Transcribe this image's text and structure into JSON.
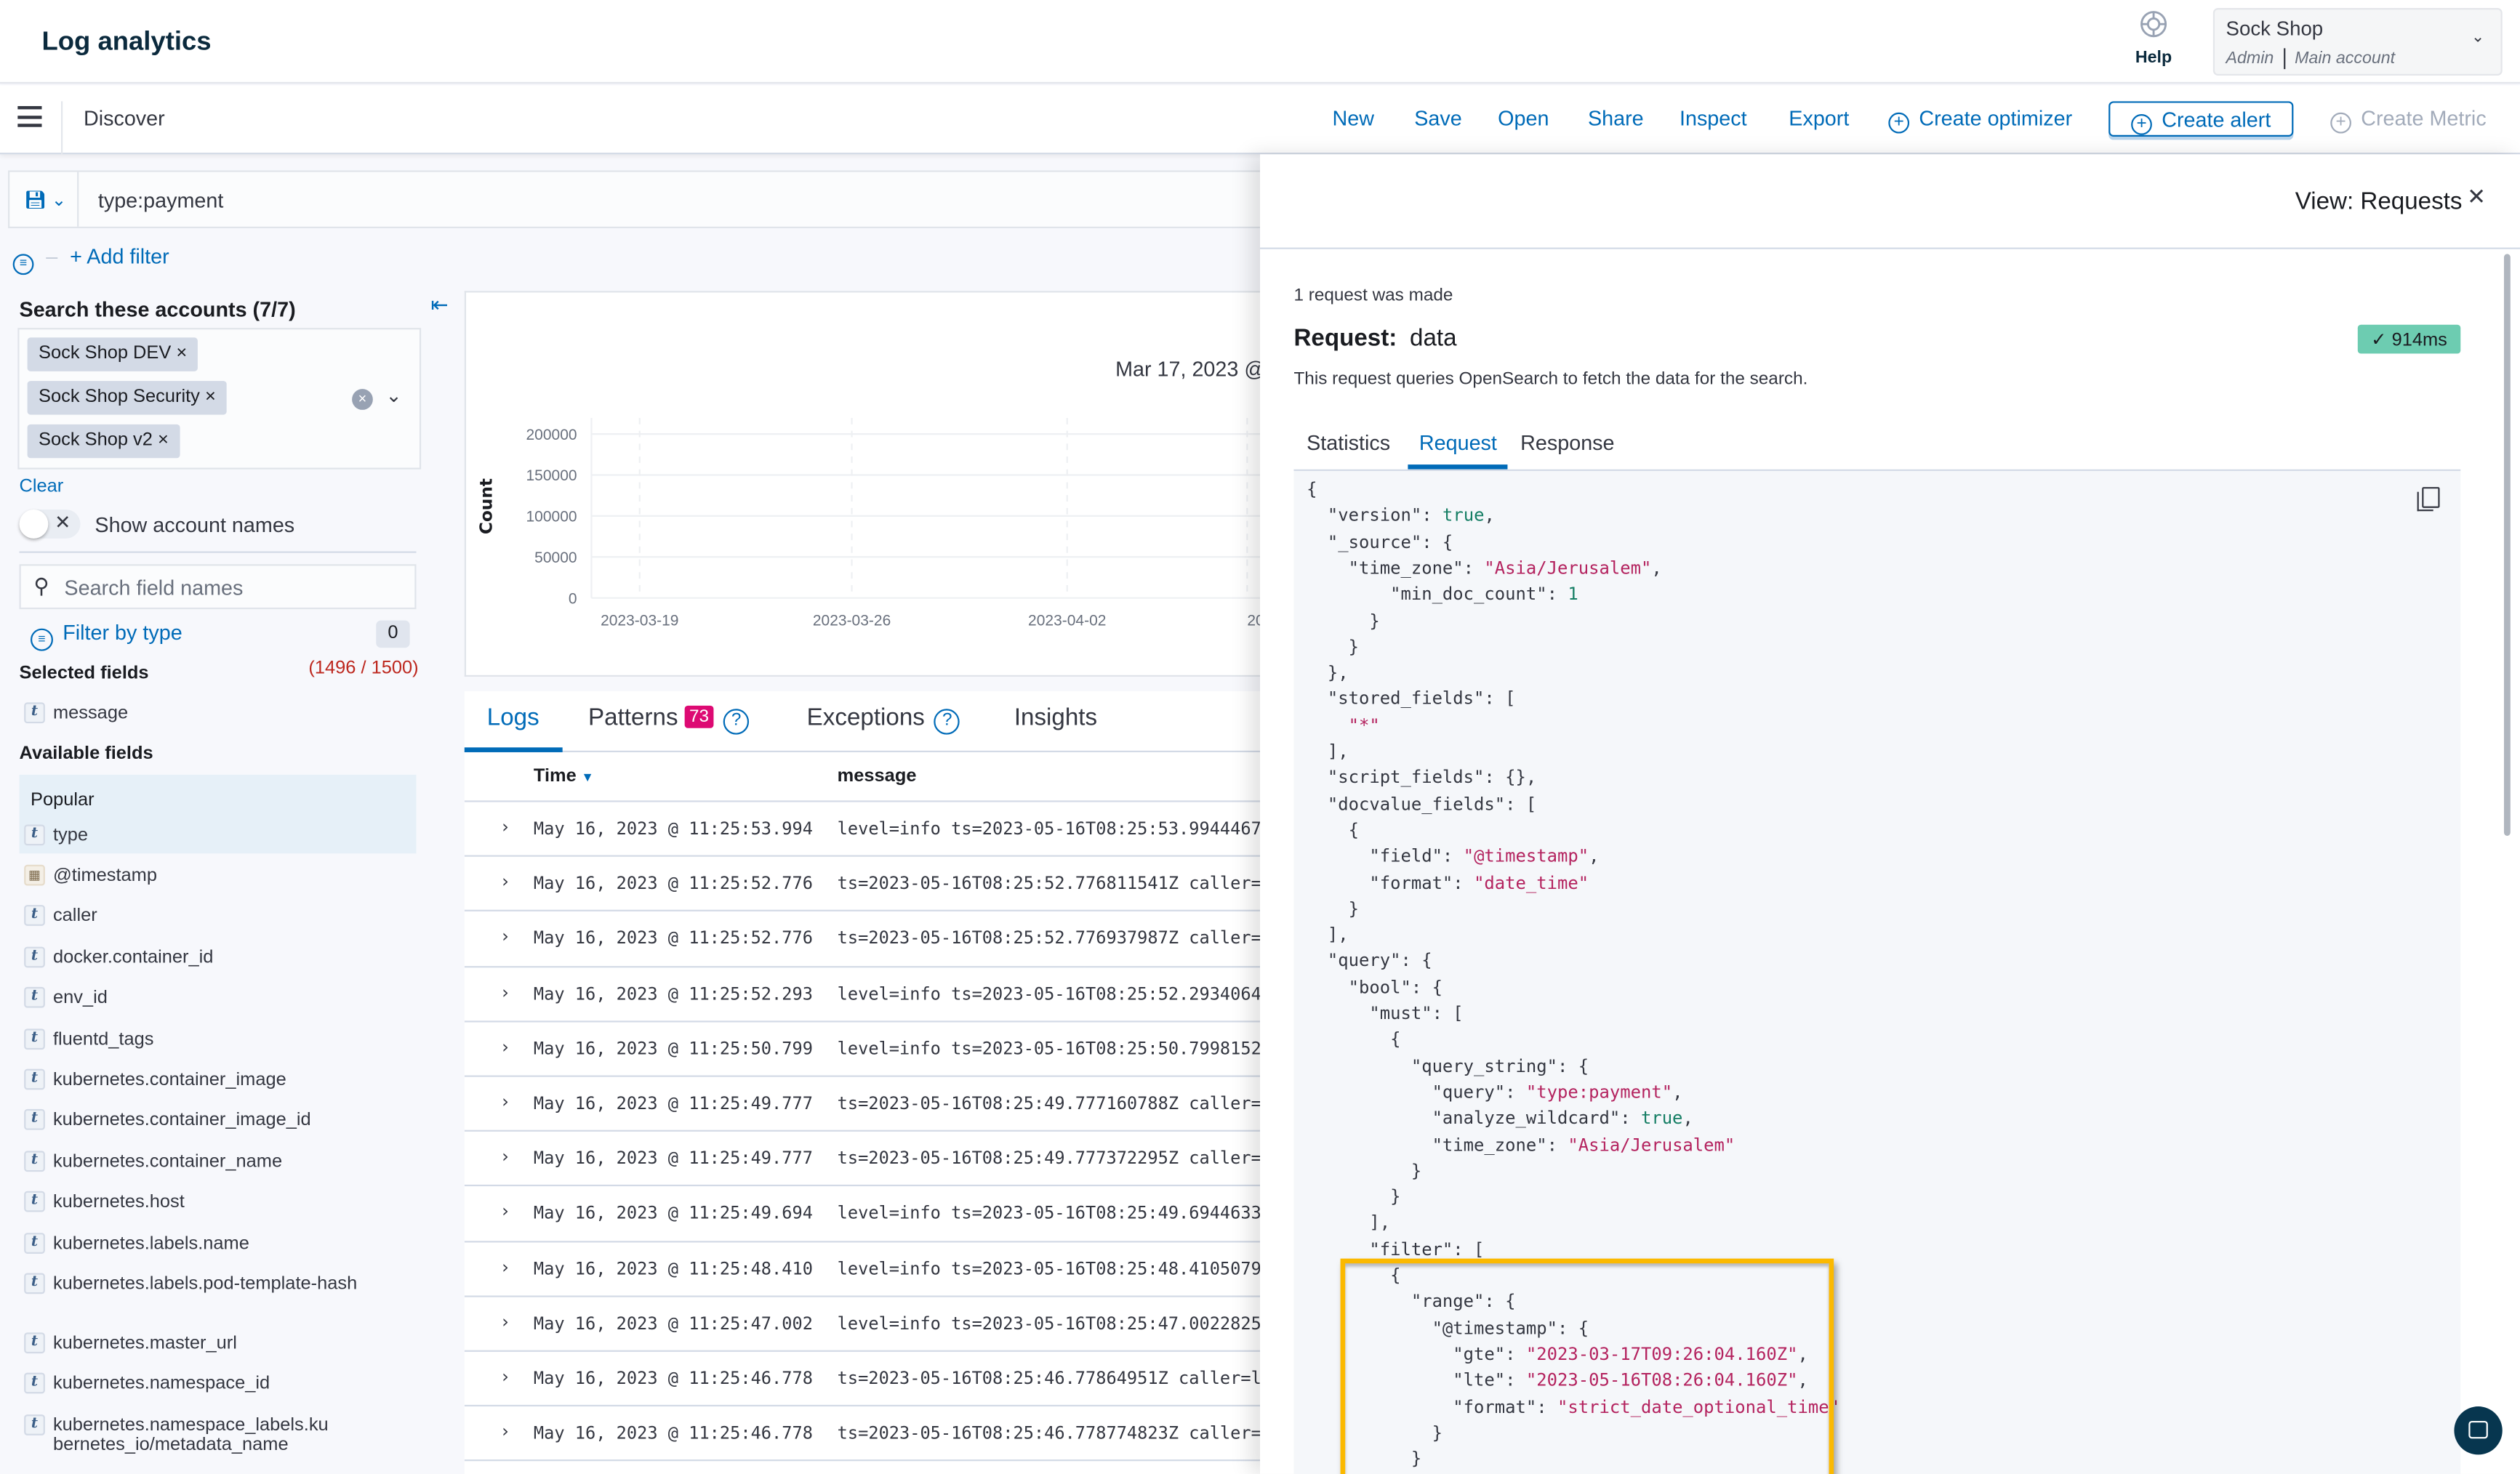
{
  "header": {
    "app_title": "Log analytics",
    "help_label": "Help",
    "account": {
      "name": "Sock Shop",
      "role": "Admin",
      "scope": "Main account"
    }
  },
  "toolbar": {
    "page": "Discover",
    "actions": [
      "New",
      "Save",
      "Open",
      "Share",
      "Inspect",
      "Export"
    ],
    "create_optimizer": "Create optimizer",
    "create_alert": "Create alert",
    "create_metric": "Create Metric"
  },
  "query": {
    "value": "type:payment",
    "add_filter": "+ Add filter"
  },
  "sidebar": {
    "accounts_title": "Search these accounts (7/7)",
    "accounts": [
      "Sock Shop DEV",
      "Sock Shop Security",
      "Sock Shop v2"
    ],
    "clear": "Clear",
    "show_account_names": "Show account names",
    "show_account_names_on": false,
    "search_placeholder": "Search field names",
    "filter_by_type": "Filter by type",
    "filter_count": "0",
    "selected_title": "Selected fields",
    "selected_count": "(1496 / 1500)",
    "selected_fields": [
      {
        "name": "message",
        "type": "string"
      }
    ],
    "available_title": "Available fields",
    "popular_label": "Popular",
    "popular_fields": [
      {
        "name": "type",
        "type": "string"
      }
    ],
    "available_fields": [
      {
        "name": "@timestamp",
        "type": "date"
      },
      {
        "name": "caller",
        "type": "string"
      },
      {
        "name": "docker.container_id",
        "type": "string"
      },
      {
        "name": "env_id",
        "type": "string"
      },
      {
        "name": "fluentd_tags",
        "type": "string"
      },
      {
        "name": "kubernetes.container_image",
        "type": "string"
      },
      {
        "name": "kubernetes.container_image_id",
        "type": "string"
      },
      {
        "name": "kubernetes.container_name",
        "type": "string"
      },
      {
        "name": "kubernetes.host",
        "type": "string"
      },
      {
        "name": "kubernetes.labels.name",
        "type": "string"
      },
      {
        "name": "kubernetes.labels.pod-template-hash",
        "type": "string"
      },
      {
        "name": "kubernetes.master_url",
        "type": "string"
      },
      {
        "name": "kubernetes.namespace_id",
        "type": "string"
      },
      {
        "name": "kubernetes.namespace_labels.kubernetes_io/metadata_name",
        "type": "string"
      }
    ]
  },
  "histogram": {
    "time_range_label": "Mar 17, 2023 @",
    "ylabel": "Count",
    "y_ticks": [
      "200000",
      "150000",
      "100000",
      "50000",
      "0"
    ],
    "x_ticks": [
      "2023-03-19",
      "2023-03-26",
      "2023-04-02",
      "20"
    ]
  },
  "chart_data": {
    "type": "bar",
    "ylabel": "Count",
    "ylim": [
      0,
      200000
    ],
    "y_ticks": [
      0,
      50000,
      100000,
      150000,
      200000
    ],
    "x_ticks": [
      "2023-03-19",
      "2023-03-26",
      "2023-04-02"
    ],
    "grid": true,
    "series": []
  },
  "log_tabs": {
    "logs": "Logs",
    "patterns": "Patterns",
    "patterns_count": "73",
    "exceptions": "Exceptions",
    "insights": "Insights"
  },
  "log_table": {
    "columns": [
      "Time",
      "message"
    ],
    "rows": [
      {
        "time": "May 16, 2023 @ 11:25:53.994",
        "message": "level=info ts=2023-05-16T08:25:53.9944467"
      },
      {
        "time": "May 16, 2023 @ 11:25:52.776",
        "message": "ts=2023-05-16T08:25:52.776811541Z caller="
      },
      {
        "time": "May 16, 2023 @ 11:25:52.776",
        "message": "ts=2023-05-16T08:25:52.776937987Z caller="
      },
      {
        "time": "May 16, 2023 @ 11:25:52.293",
        "message": "level=info ts=2023-05-16T08:25:52.2934064"
      },
      {
        "time": "May 16, 2023 @ 11:25:50.799",
        "message": "level=info ts=2023-05-16T08:25:50.7998152"
      },
      {
        "time": "May 16, 2023 @ 11:25:49.777",
        "message": "ts=2023-05-16T08:25:49.777160788Z caller="
      },
      {
        "time": "May 16, 2023 @ 11:25:49.777",
        "message": "ts=2023-05-16T08:25:49.777372295Z caller="
      },
      {
        "time": "May 16, 2023 @ 11:25:49.694",
        "message": "level=info ts=2023-05-16T08:25:49.6944633"
      },
      {
        "time": "May 16, 2023 @ 11:25:48.410",
        "message": "level=info ts=2023-05-16T08:25:48.4105079"
      },
      {
        "time": "May 16, 2023 @ 11:25:47.002",
        "message": "level=info ts=2023-05-16T08:25:47.0022825"
      },
      {
        "time": "May 16, 2023 @ 11:25:46.778",
        "message": "ts=2023-05-16T08:25:46.77864951Z caller=l"
      },
      {
        "time": "May 16, 2023 @ 11:25:46.778",
        "message": "ts=2023-05-16T08:25:46.778774823Z caller="
      }
    ]
  },
  "inspector": {
    "title": "View: Requests",
    "requests_made": "1 request was made",
    "request_label": "Request:",
    "request_name": "data",
    "duration": "914ms",
    "duration_color": "#6dccb1",
    "description": "This request queries OpenSearch to fetch the data for the search.",
    "tabs": [
      "Statistics",
      "Request",
      "Response"
    ],
    "active_tab": "Request",
    "highlight_color": "#fbb900",
    "code_lines": [
      [
        [
          "{",
          "p"
        ]
      ],
      [
        [
          "  \"version\": ",
          "p"
        ],
        [
          "true",
          "b"
        ],
        [
          ",",
          "p"
        ]
      ],
      [
        [
          "  \"_source\": {",
          "p"
        ]
      ],
      [
        [
          "    \"time_zone\": ",
          "p"
        ],
        [
          "\"Asia/Jerusalem\"",
          "s"
        ],
        [
          ",",
          "p"
        ]
      ],
      [
        [
          "        \"min_doc_count\": ",
          "p"
        ],
        [
          "1",
          "n"
        ]
      ],
      [
        [
          "      }",
          "p"
        ]
      ],
      [
        [
          "    }",
          "p"
        ]
      ],
      [
        [
          "  },",
          "p"
        ]
      ],
      [
        [
          "  \"stored_fields\": [",
          "p"
        ]
      ],
      [
        [
          "    ",
          "p"
        ],
        [
          "\"*\"",
          "s"
        ]
      ],
      [
        [
          "  ],",
          "p"
        ]
      ],
      [
        [
          "  \"script_fields\": {},",
          "p"
        ]
      ],
      [
        [
          "  \"docvalue_fields\": [",
          "p"
        ]
      ],
      [
        [
          "    {",
          "p"
        ]
      ],
      [
        [
          "      \"field\": ",
          "p"
        ],
        [
          "\"@timestamp\"",
          "s"
        ],
        [
          ",",
          "p"
        ]
      ],
      [
        [
          "      \"format\": ",
          "p"
        ],
        [
          "\"date_time\"",
          "s"
        ]
      ],
      [
        [
          "    }",
          "p"
        ]
      ],
      [
        [
          "  ],",
          "p"
        ]
      ],
      [
        [
          "  \"query\": {",
          "p"
        ]
      ],
      [
        [
          "    \"bool\": {",
          "p"
        ]
      ],
      [
        [
          "      \"must\": [",
          "p"
        ]
      ],
      [
        [
          "        {",
          "p"
        ]
      ],
      [
        [
          "          \"query_string\": {",
          "p"
        ]
      ],
      [
        [
          "            \"query\": ",
          "p"
        ],
        [
          "\"type:payment\"",
          "s"
        ],
        [
          ",",
          "p"
        ]
      ],
      [
        [
          "            \"analyze_wildcard\": ",
          "p"
        ],
        [
          "true",
          "b"
        ],
        [
          ",",
          "p"
        ]
      ],
      [
        [
          "            \"time_zone\": ",
          "p"
        ],
        [
          "\"Asia/Jerusalem\"",
          "s"
        ]
      ],
      [
        [
          "          }",
          "p"
        ]
      ],
      [
        [
          "        }",
          "p"
        ]
      ],
      [
        [
          "      ],",
          "p"
        ]
      ],
      [
        [
          "      \"filter\": [",
          "p"
        ]
      ],
      [
        [
          "        {",
          "p"
        ]
      ],
      [
        [
          "          \"range\": {",
          "p"
        ]
      ],
      [
        [
          "            \"@timestamp\": {",
          "p"
        ]
      ],
      [
        [
          "              \"gte\": ",
          "p"
        ],
        [
          "\"2023-03-17T09:26:04.160Z\"",
          "s"
        ],
        [
          ",",
          "p"
        ]
      ],
      [
        [
          "              \"lte\": ",
          "p"
        ],
        [
          "\"2023-05-16T08:26:04.160Z\"",
          "s"
        ],
        [
          ",",
          "p"
        ]
      ],
      [
        [
          "              \"format\": ",
          "p"
        ],
        [
          "\"strict_date_optional_time\"",
          "s"
        ]
      ],
      [
        [
          "            }",
          "p"
        ]
      ],
      [
        [
          "          }",
          "p"
        ]
      ]
    ]
  }
}
